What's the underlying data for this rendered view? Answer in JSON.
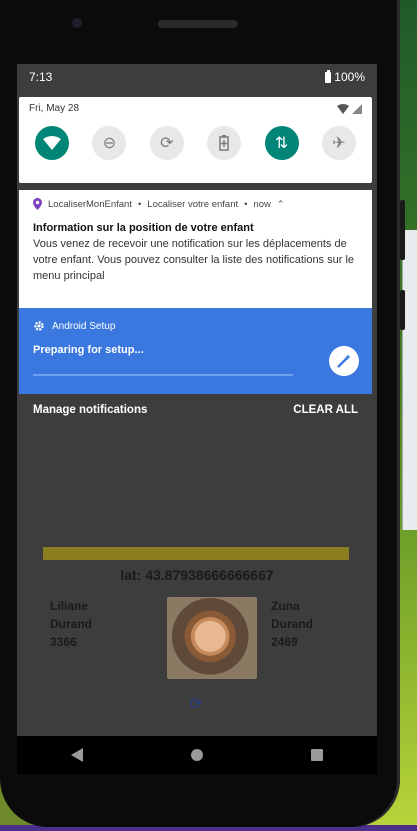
{
  "status_bar": {
    "time": "7:13",
    "battery": "100%"
  },
  "quick_settings": {
    "date": "Fri, May 28",
    "tiles": [
      {
        "name": "wifi",
        "icon": "▼",
        "active": true
      },
      {
        "name": "do-not-disturb",
        "icon": "⊖",
        "active": false
      },
      {
        "name": "auto-rotate",
        "icon": "⟳",
        "active": false
      },
      {
        "name": "battery-saver",
        "icon": "▯",
        "active": false
      },
      {
        "name": "mobile-data",
        "icon": "⇅",
        "active": true
      },
      {
        "name": "airplane-mode",
        "icon": "✈",
        "active": false
      }
    ]
  },
  "notification_location": {
    "app_name": "LocaliserMonEnfant",
    "subtitle": "Localiser votre enfant",
    "time": "now",
    "title": "Information sur la position de votre enfant",
    "body": "Vous venez de recevoir une notification sur les déplacements de votre enfant. Vous pouvez consulter la liste des notifications sur le menu principal"
  },
  "notification_setup": {
    "app_name": "Android Setup",
    "title": "Preparing for setup..."
  },
  "shade_footer": {
    "manage_label": "Manage notifications",
    "clear_label": "CLEAR ALL"
  },
  "app": {
    "lat_label": "lat: 43.87938666666667",
    "child_left": {
      "first": "Liliane",
      "last": "Durand",
      "id": "3366"
    },
    "child_right": {
      "first": "Zuna",
      "last": "Durand",
      "id": "2469"
    }
  },
  "colors": {
    "accent": "#008577",
    "setup_blue": "#3a78e0",
    "shade_bg": "#3d3d3d"
  }
}
